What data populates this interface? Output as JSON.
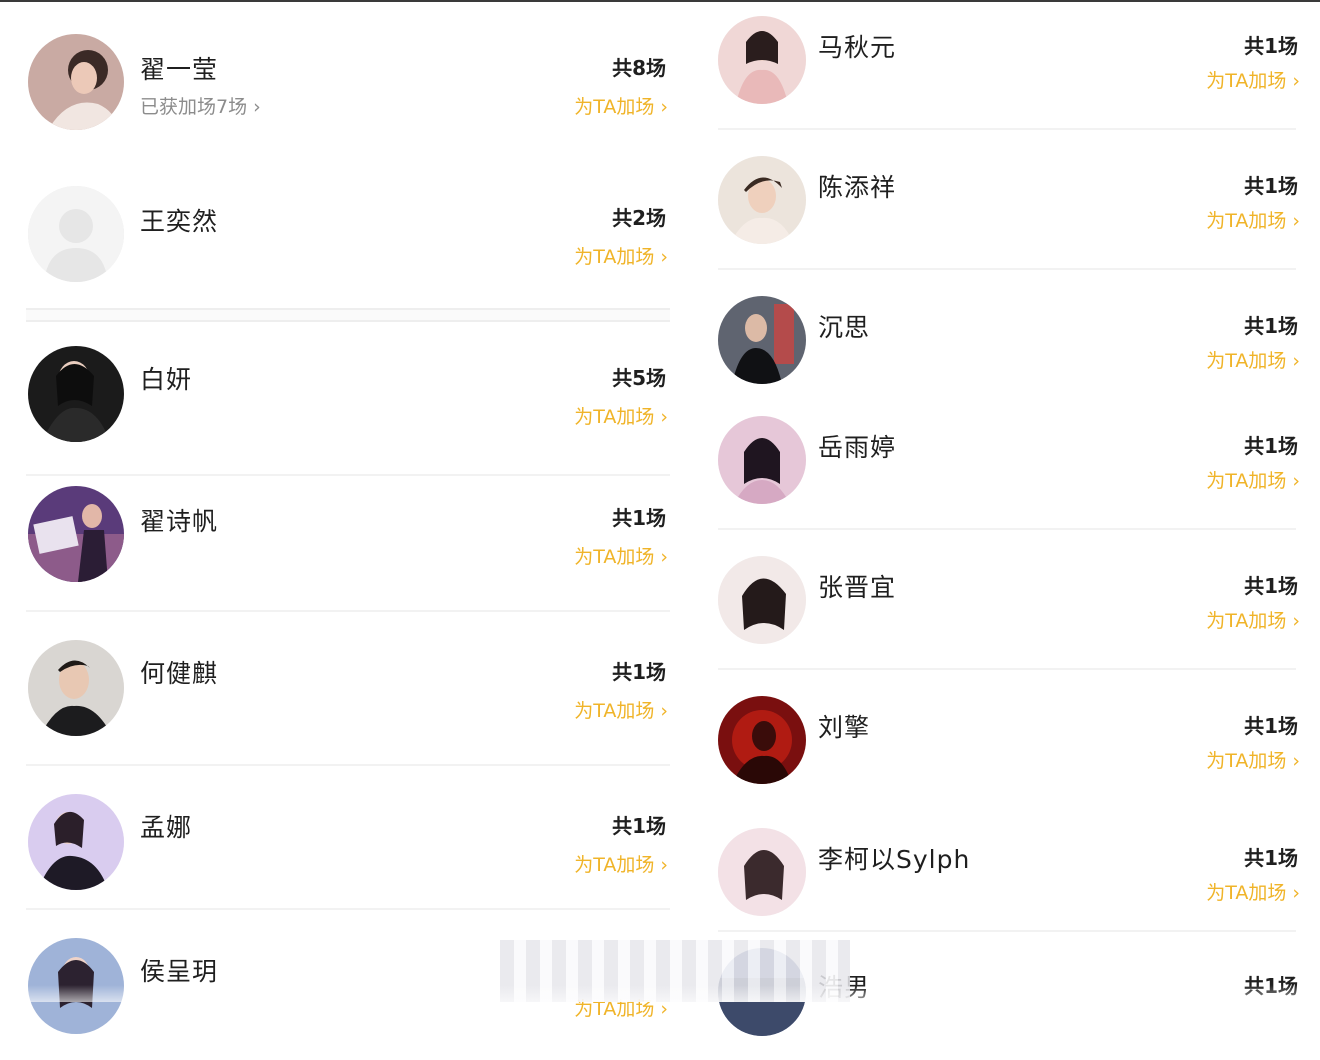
{
  "left_column": [
    {
      "name": "翟一莹",
      "subtitle": "已获加场7场 ›",
      "count": "共8场",
      "action": "为TA加场 ›",
      "avatar": "avatar-1"
    },
    {
      "name": "王奕然",
      "subtitle": "",
      "count": "共2场",
      "action": "为TA加场 ›",
      "avatar": "avatar-placeholder"
    },
    {
      "name": "白妍",
      "subtitle": "",
      "count": "共5场",
      "action": "为TA加场 ›",
      "avatar": "avatar-3"
    },
    {
      "name": "翟诗帆",
      "subtitle": "",
      "count": "共1场",
      "action": "为TA加场 ›",
      "avatar": "avatar-4"
    },
    {
      "name": "何健麒",
      "subtitle": "",
      "count": "共1场",
      "action": "为TA加场 ›",
      "avatar": "avatar-5"
    },
    {
      "name": "孟娜",
      "subtitle": "",
      "count": "共1场",
      "action": "为TA加场 ›",
      "avatar": "avatar-6"
    },
    {
      "name": "侯呈玥",
      "subtitle": "",
      "count": "",
      "action": "为TA加场 ›",
      "avatar": "avatar-7"
    }
  ],
  "right_column": [
    {
      "name": "马秋元",
      "count": "共1场",
      "action": "为TA加场 ›",
      "avatar": "avatar-8"
    },
    {
      "name": "陈添祥",
      "count": "共1场",
      "action": "为TA加场 ›",
      "avatar": "avatar-9"
    },
    {
      "name": "沉思",
      "count": "共1场",
      "action": "为TA加场 ›",
      "avatar": "avatar-10"
    },
    {
      "name": "岳雨婷",
      "count": "共1场",
      "action": "为TA加场 ›",
      "avatar": "avatar-11"
    },
    {
      "name": "张晋宜",
      "count": "共1场",
      "action": "为TA加场 ›",
      "avatar": "avatar-12"
    },
    {
      "name": "刘擎",
      "count": "共1场",
      "action": "为TA加场 ›",
      "avatar": "avatar-13"
    },
    {
      "name": "李柯以Sylph",
      "count": "共1场",
      "action": "为TA加场 ›",
      "avatar": "avatar-14"
    },
    {
      "name": "浩男",
      "count": "共1场",
      "action": "",
      "avatar": "avatar-15"
    }
  ],
  "colors": {
    "action": "#f0b429",
    "name": "#1f1f1f",
    "subtitle": "#8c8c8c",
    "divider": "#f2f2f2"
  }
}
